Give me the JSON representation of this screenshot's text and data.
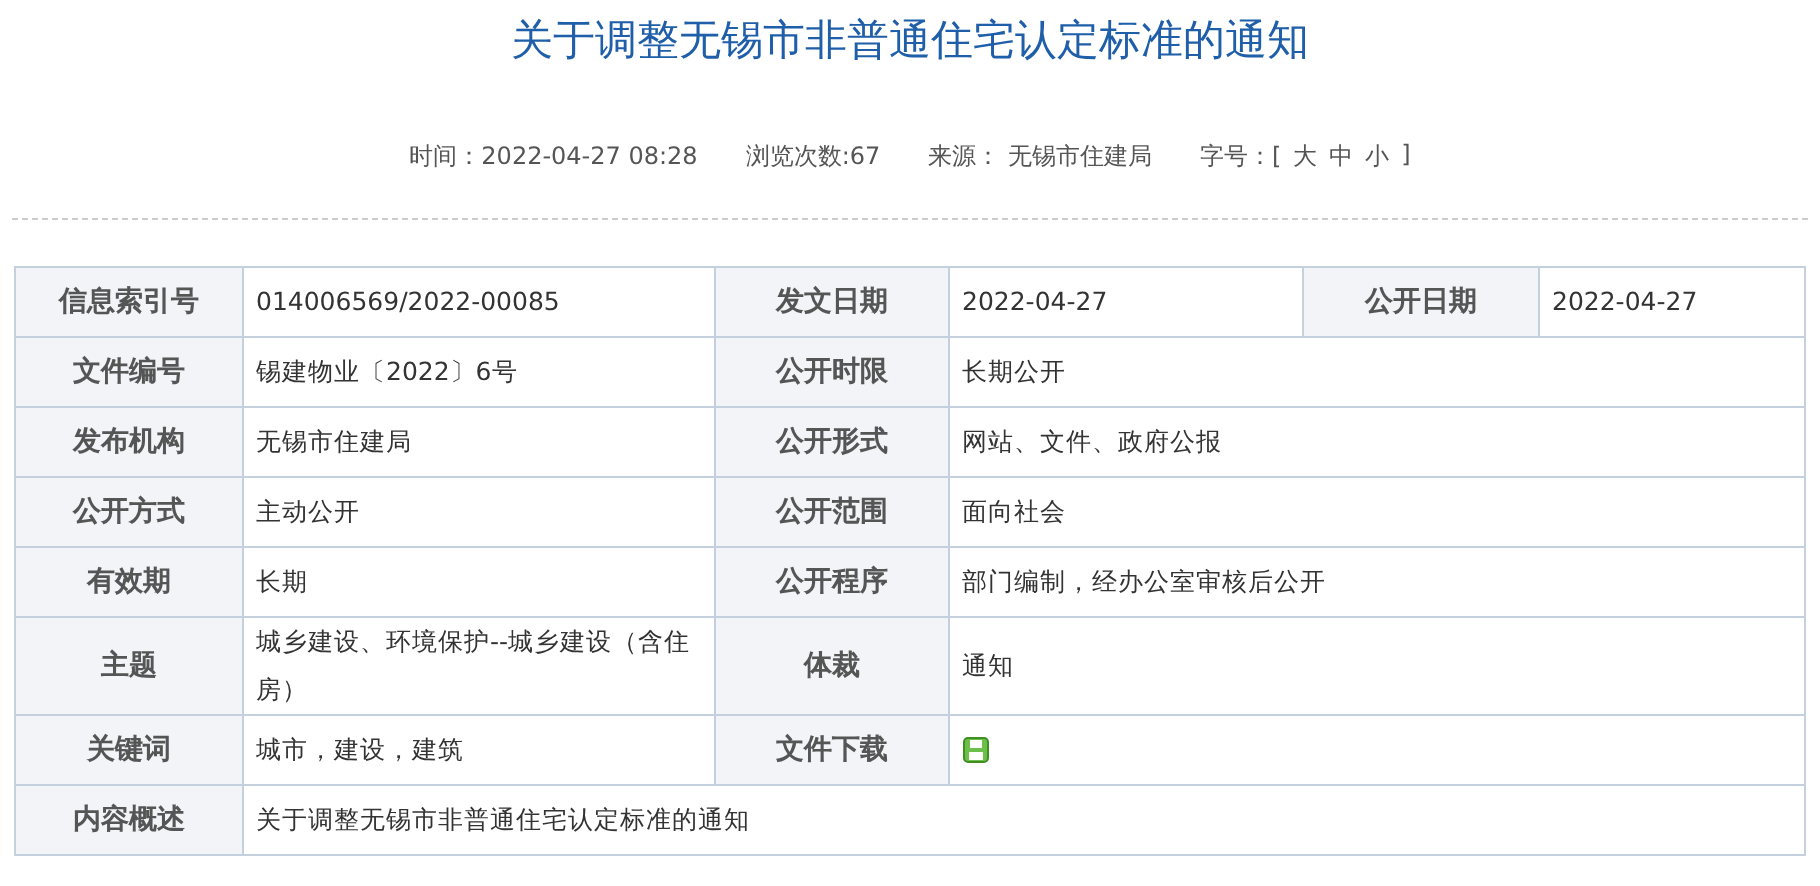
{
  "title": "关于调整无锡市非普通住宅认定标准的通知",
  "meta": [
    "时间：2022-04-27 08:28",
    "浏览次数:67",
    "来源： 无锡市住建局"
  ],
  "font_size": {
    "label": "字号：[",
    "options": [
      "大",
      "中",
      "小"
    ],
    "close": "]"
  },
  "rows": [
    {
      "cells": [
        {
          "kind": "label",
          "text": "信息索引号"
        },
        {
          "kind": "value",
          "text": "014006569/2022-00085"
        },
        {
          "kind": "label",
          "text": "发文日期"
        },
        {
          "kind": "value",
          "text": "2022-04-27"
        },
        {
          "kind": "label",
          "text": "公开日期"
        },
        {
          "kind": "value",
          "text": "2022-04-27"
        }
      ]
    },
    {
      "cells": [
        {
          "kind": "label",
          "text": "文件编号"
        },
        {
          "kind": "value",
          "text": "锡建物业〔2022〕6号"
        },
        {
          "kind": "label",
          "text": "公开时限"
        },
        {
          "kind": "value",
          "text": "长期公开"
        }
      ]
    },
    {
      "cells": [
        {
          "kind": "label",
          "text": "发布机构"
        },
        {
          "kind": "value",
          "text": "无锡市住建局"
        },
        {
          "kind": "label",
          "text": "公开形式"
        },
        {
          "kind": "value",
          "text": "网站、文件、政府公报"
        }
      ]
    },
    {
      "cells": [
        {
          "kind": "label",
          "text": "公开方式"
        },
        {
          "kind": "value",
          "text": "主动公开"
        },
        {
          "kind": "label",
          "text": "公开范围"
        },
        {
          "kind": "value",
          "text": "面向社会"
        }
      ]
    },
    {
      "cells": [
        {
          "kind": "label",
          "text": "有效期"
        },
        {
          "kind": "value",
          "text": "长期"
        },
        {
          "kind": "label",
          "text": "公开程序"
        },
        {
          "kind": "value",
          "text": "部门编制，经办公室审核后公开"
        }
      ]
    },
    {
      "cells": [
        {
          "kind": "label",
          "text": "主题"
        },
        {
          "kind": "value",
          "text": "城乡建设、环境保护--城乡建设（含住房）"
        },
        {
          "kind": "label",
          "text": "体裁"
        },
        {
          "kind": "value",
          "text": "通知"
        }
      ]
    },
    {
      "cells": [
        {
          "kind": "label",
          "text": "关键词"
        },
        {
          "kind": "value",
          "text": "城市，建设，建筑"
        },
        {
          "kind": "label",
          "text": "文件下载"
        },
        {
          "kind": "download"
        }
      ]
    },
    {
      "cells": [
        {
          "kind": "label",
          "text": "内容概述"
        },
        {
          "kind": "value",
          "text": "关于调整无锡市非普通住宅认定标准的通知"
        }
      ]
    }
  ]
}
